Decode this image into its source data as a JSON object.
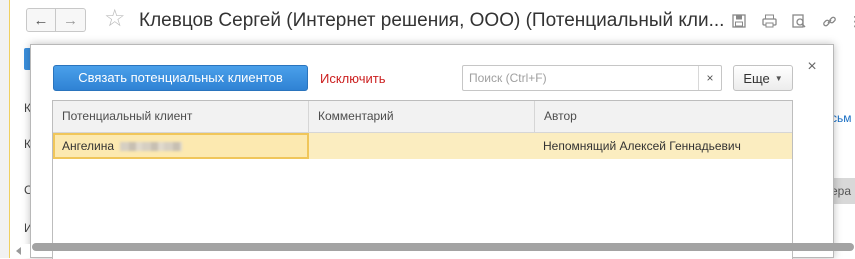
{
  "background": {
    "title": "Клевцов Сергей (Интернет решения, ООО) (Потенциальный кли...",
    "nav": {
      "back_icon": "arrow-left-icon",
      "forward_icon": "arrow-right-icon"
    },
    "favorite_icon": "star-icon",
    "toolbar_icons": [
      "save-icon",
      "print-icon",
      "preview-icon",
      "link-icon",
      "more-icon"
    ],
    "left_labels": [
      "К",
      "К",
      "С",
      "И"
    ],
    "right_link": "сьм",
    "right_button": "ера"
  },
  "modal": {
    "primary_button": "Связать потенциальных клиентов",
    "exclude_button": "Исключить",
    "search": {
      "placeholder": "Поиск (Ctrl+F)",
      "value": "",
      "clear_icon": "close-icon"
    },
    "more_button": "Еще",
    "close_icon": "close-icon",
    "table": {
      "columns": [
        "Потенциальный клиент",
        "Комментарий",
        "Автор"
      ],
      "rows": [
        {
          "client": "Ангелина",
          "comment": "",
          "author": "Непомнящий Алексей Геннадьевич"
        }
      ]
    }
  },
  "colors": {
    "accent": "#3b8fdd",
    "exclude": "#cc1f1f",
    "row_selected": "#fbedc0",
    "cell_focus_border": "#f0c65a",
    "header_bg": "#f2f2f2"
  }
}
